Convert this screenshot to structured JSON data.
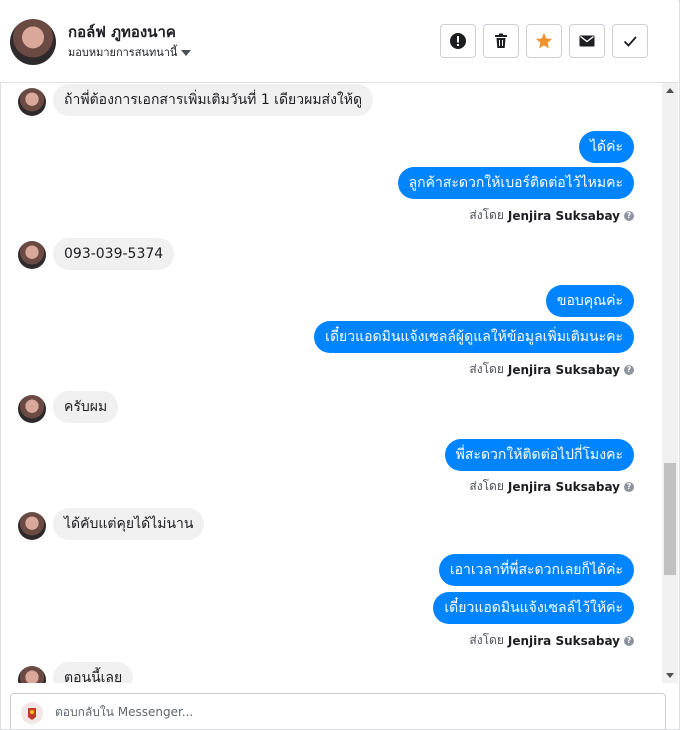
{
  "header": {
    "contact_name": "กอล์ฟ ภูทองนาค",
    "assign_label": "มอบหมายการสนทนานี้",
    "accent": "#f0932b"
  },
  "messages": [
    {
      "dir": "in",
      "text": "ถ้าพี่ต้องการเอกสารเพิ่มเติมวันที่ 1 เดียวผมส่งให้ดู"
    },
    {
      "dir": "out",
      "text": "ได้ค่ะ"
    },
    {
      "dir": "out",
      "text": "ลูกค้าสะดวกให้เบอร์ติดต่อไว้ไหมคะ"
    },
    {
      "dir": "in",
      "text": "093-039-5374"
    },
    {
      "dir": "out",
      "text": "ขอบคุณค่ะ"
    },
    {
      "dir": "out",
      "text": "เดี๋ยวแอดมินแจ้งเซลล์ผู้ดูแลให้ข้อมูลเพิ่มเติมนะคะ"
    },
    {
      "dir": "in",
      "text": "ครับผม"
    },
    {
      "dir": "out",
      "text": "พี่สะดวกให้ติดต่อไปกี่โมงคะ"
    },
    {
      "dir": "in",
      "text": "ได้คับแต่คุยได้ไม่นาน"
    },
    {
      "dir": "out",
      "text": "เอาเวลาที่พี่สะดวกเลยก็ได้ค่ะ"
    },
    {
      "dir": "out",
      "text": "เดี๋ยวแอดมินแจ้งเซลล์ไว้ให้ค่ะ"
    },
    {
      "dir": "in",
      "text": "ตอนนี้เลย"
    }
  ],
  "sent_by": {
    "prefix": "ส่งโดย",
    "name": "Jenjira Suksabay",
    "help": "?"
  },
  "composer": {
    "placeholder": "ตอบกลับใน Messenger..."
  },
  "colors": {
    "outgoing_bubble": "#0084ff",
    "incoming_bubble": "#f1f0f0"
  }
}
